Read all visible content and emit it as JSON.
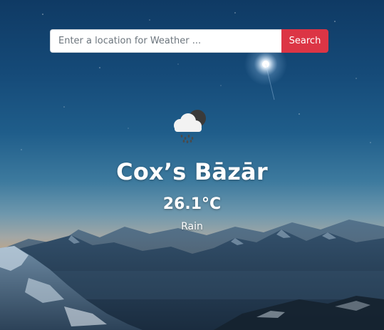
{
  "search": {
    "placeholder": "Enter a location for Weather ...",
    "value": "",
    "button_label": "Search"
  },
  "weather": {
    "icon": "rain-cloud-moon-icon",
    "city": "Cox’s Bāzār",
    "temperature": "26.1°C",
    "condition": "Rain"
  },
  "colors": {
    "accent": "#dc3545",
    "text": "#ffffff"
  }
}
